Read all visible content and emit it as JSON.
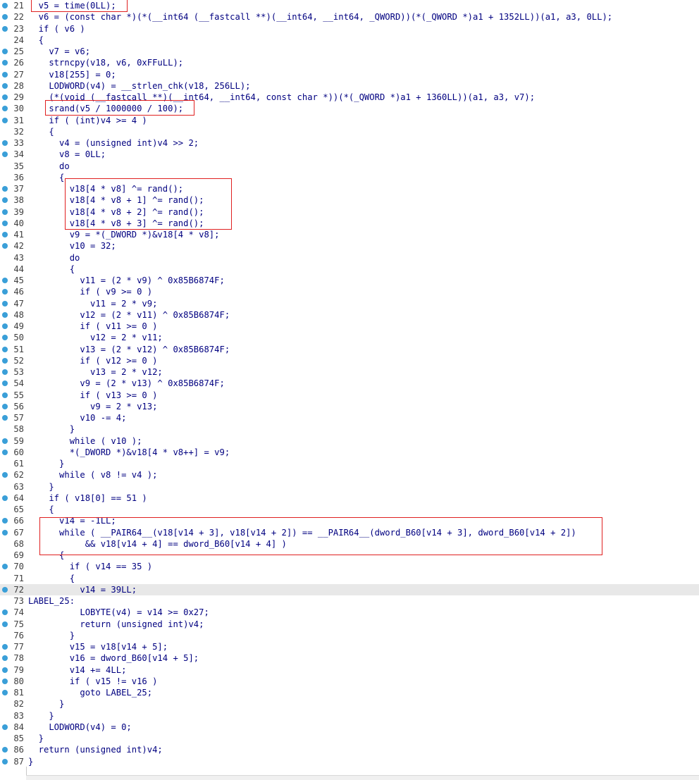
{
  "colors": {
    "keyword_text": "#000080",
    "variable_text": "#8080a0",
    "line_number": "#404040",
    "breakpoint_dot": "#3a9fd8",
    "highlight_box": "#e02020",
    "current_line_bg": "#e8e8e8"
  },
  "lines": [
    {
      "num": "21",
      "dot": true,
      "text": "  v5 = time(0LL);"
    },
    {
      "num": "22",
      "dot": true,
      "text": "  v6 = (const char *)(*(__int64 (__fastcall **)(__int64, __int64, _QWORD))(*(_QWORD *)a1 + 1352LL))(a1, a3, 0LL);"
    },
    {
      "num": "23",
      "dot": true,
      "text": "  if ( v6 )"
    },
    {
      "num": "24",
      "dot": false,
      "text": "  {"
    },
    {
      "num": "25",
      "dot": true,
      "text": "    v7 = v6;"
    },
    {
      "num": "26",
      "dot": true,
      "text": "    strncpy(v18, v6, 0xFFuLL);"
    },
    {
      "num": "27",
      "dot": true,
      "text": "    v18[255] = 0;"
    },
    {
      "num": "28",
      "dot": true,
      "text": "    LODWORD(v4) = __strlen_chk(v18, 256LL);"
    },
    {
      "num": "29",
      "dot": true,
      "text": "    (*(void (__fastcall **)(__int64, __int64, const char *))(*(_QWORD *)a1 + 1360LL))(a1, a3, v7);"
    },
    {
      "num": "30",
      "dot": true,
      "text": "    srand(v5 / 1000000 / 100);"
    },
    {
      "num": "31",
      "dot": true,
      "text": "    if ( (int)v4 >= 4 )"
    },
    {
      "num": "32",
      "dot": false,
      "text": "    {"
    },
    {
      "num": "33",
      "dot": true,
      "text": "      v4 = (unsigned int)v4 >> 2;"
    },
    {
      "num": "34",
      "dot": true,
      "text": "      v8 = 0LL;"
    },
    {
      "num": "35",
      "dot": false,
      "text": "      do"
    },
    {
      "num": "36",
      "dot": false,
      "text": "      {"
    },
    {
      "num": "37",
      "dot": true,
      "text": "        v18[4 * v8] ^= rand();"
    },
    {
      "num": "38",
      "dot": true,
      "text": "        v18[4 * v8 + 1] ^= rand();"
    },
    {
      "num": "39",
      "dot": true,
      "text": "        v18[4 * v8 + 2] ^= rand();"
    },
    {
      "num": "40",
      "dot": true,
      "text": "        v18[4 * v8 + 3] ^= rand();"
    },
    {
      "num": "41",
      "dot": true,
      "text": "        v9 = *(_DWORD *)&v18[4 * v8];"
    },
    {
      "num": "42",
      "dot": true,
      "text": "        v10 = 32;"
    },
    {
      "num": "43",
      "dot": false,
      "text": "        do"
    },
    {
      "num": "44",
      "dot": false,
      "text": "        {"
    },
    {
      "num": "45",
      "dot": true,
      "text": "          v11 = (2 * v9) ^ 0x85B6874F;"
    },
    {
      "num": "46",
      "dot": true,
      "text": "          if ( v9 >= 0 )"
    },
    {
      "num": "47",
      "dot": true,
      "text": "            v11 = 2 * v9;"
    },
    {
      "num": "48",
      "dot": true,
      "text": "          v12 = (2 * v11) ^ 0x85B6874F;"
    },
    {
      "num": "49",
      "dot": true,
      "text": "          if ( v11 >= 0 )"
    },
    {
      "num": "50",
      "dot": true,
      "text": "            v12 = 2 * v11;"
    },
    {
      "num": "51",
      "dot": true,
      "text": "          v13 = (2 * v12) ^ 0x85B6874F;"
    },
    {
      "num": "52",
      "dot": true,
      "text": "          if ( v12 >= 0 )"
    },
    {
      "num": "53",
      "dot": true,
      "text": "            v13 = 2 * v12;"
    },
    {
      "num": "54",
      "dot": true,
      "text": "          v9 = (2 * v13) ^ 0x85B6874F;"
    },
    {
      "num": "55",
      "dot": true,
      "text": "          if ( v13 >= 0 )"
    },
    {
      "num": "56",
      "dot": true,
      "text": "            v9 = 2 * v13;"
    },
    {
      "num": "57",
      "dot": true,
      "text": "          v10 -= 4;"
    },
    {
      "num": "58",
      "dot": false,
      "text": "        }"
    },
    {
      "num": "59",
      "dot": true,
      "text": "        while ( v10 );"
    },
    {
      "num": "60",
      "dot": true,
      "text": "        *(_DWORD *)&v18[4 * v8++] = v9;"
    },
    {
      "num": "61",
      "dot": false,
      "text": "      }"
    },
    {
      "num": "62",
      "dot": true,
      "text": "      while ( v8 != v4 );"
    },
    {
      "num": "63",
      "dot": false,
      "text": "    }"
    },
    {
      "num": "64",
      "dot": true,
      "text": "    if ( v18[0] == 51 )"
    },
    {
      "num": "65",
      "dot": false,
      "text": "    {"
    },
    {
      "num": "66",
      "dot": true,
      "text": "      v14 = -1LL;"
    },
    {
      "num": "67",
      "dot": true,
      "text": "      while ( __PAIR64__(v18[v14 + 3], v18[v14 + 2]) == __PAIR64__(dword_B60[v14 + 3], dword_B60[v14 + 2])"
    },
    {
      "num": "68",
      "dot": false,
      "text": "           && v18[v14 + 4] == dword_B60[v14 + 4] )"
    },
    {
      "num": "69",
      "dot": false,
      "text": "      {"
    },
    {
      "num": "70",
      "dot": true,
      "text": "        if ( v14 == 35 )"
    },
    {
      "num": "71",
      "dot": false,
      "text": "        {"
    },
    {
      "num": "72",
      "dot": true,
      "text": "          v14 = 39LL;"
    },
    {
      "num": "73",
      "dot": false,
      "text": "LABEL_25:"
    },
    {
      "num": "74",
      "dot": true,
      "text": "          LOBYTE(v4) = v14 >= 0x27;"
    },
    {
      "num": "75",
      "dot": true,
      "text": "          return (unsigned int)v4;"
    },
    {
      "num": "76",
      "dot": false,
      "text": "        }"
    },
    {
      "num": "77",
      "dot": true,
      "text": "        v15 = v18[v14 + 5];"
    },
    {
      "num": "78",
      "dot": true,
      "text": "        v16 = dword_B60[v14 + 5];"
    },
    {
      "num": "79",
      "dot": true,
      "text": "        v14 += 4LL;"
    },
    {
      "num": "80",
      "dot": true,
      "text": "        if ( v15 != v16 )"
    },
    {
      "num": "81",
      "dot": true,
      "text": "          goto LABEL_25;"
    },
    {
      "num": "82",
      "dot": false,
      "text": "      }"
    },
    {
      "num": "83",
      "dot": false,
      "text": "    }"
    },
    {
      "num": "84",
      "dot": true,
      "text": "    LODWORD(v4) = 0;"
    },
    {
      "num": "85",
      "dot": false,
      "text": "  }"
    },
    {
      "num": "86",
      "dot": true,
      "text": "  return (unsigned int)v4;"
    },
    {
      "num": "87",
      "dot": true,
      "text": "}"
    }
  ],
  "current_line": "72"
}
